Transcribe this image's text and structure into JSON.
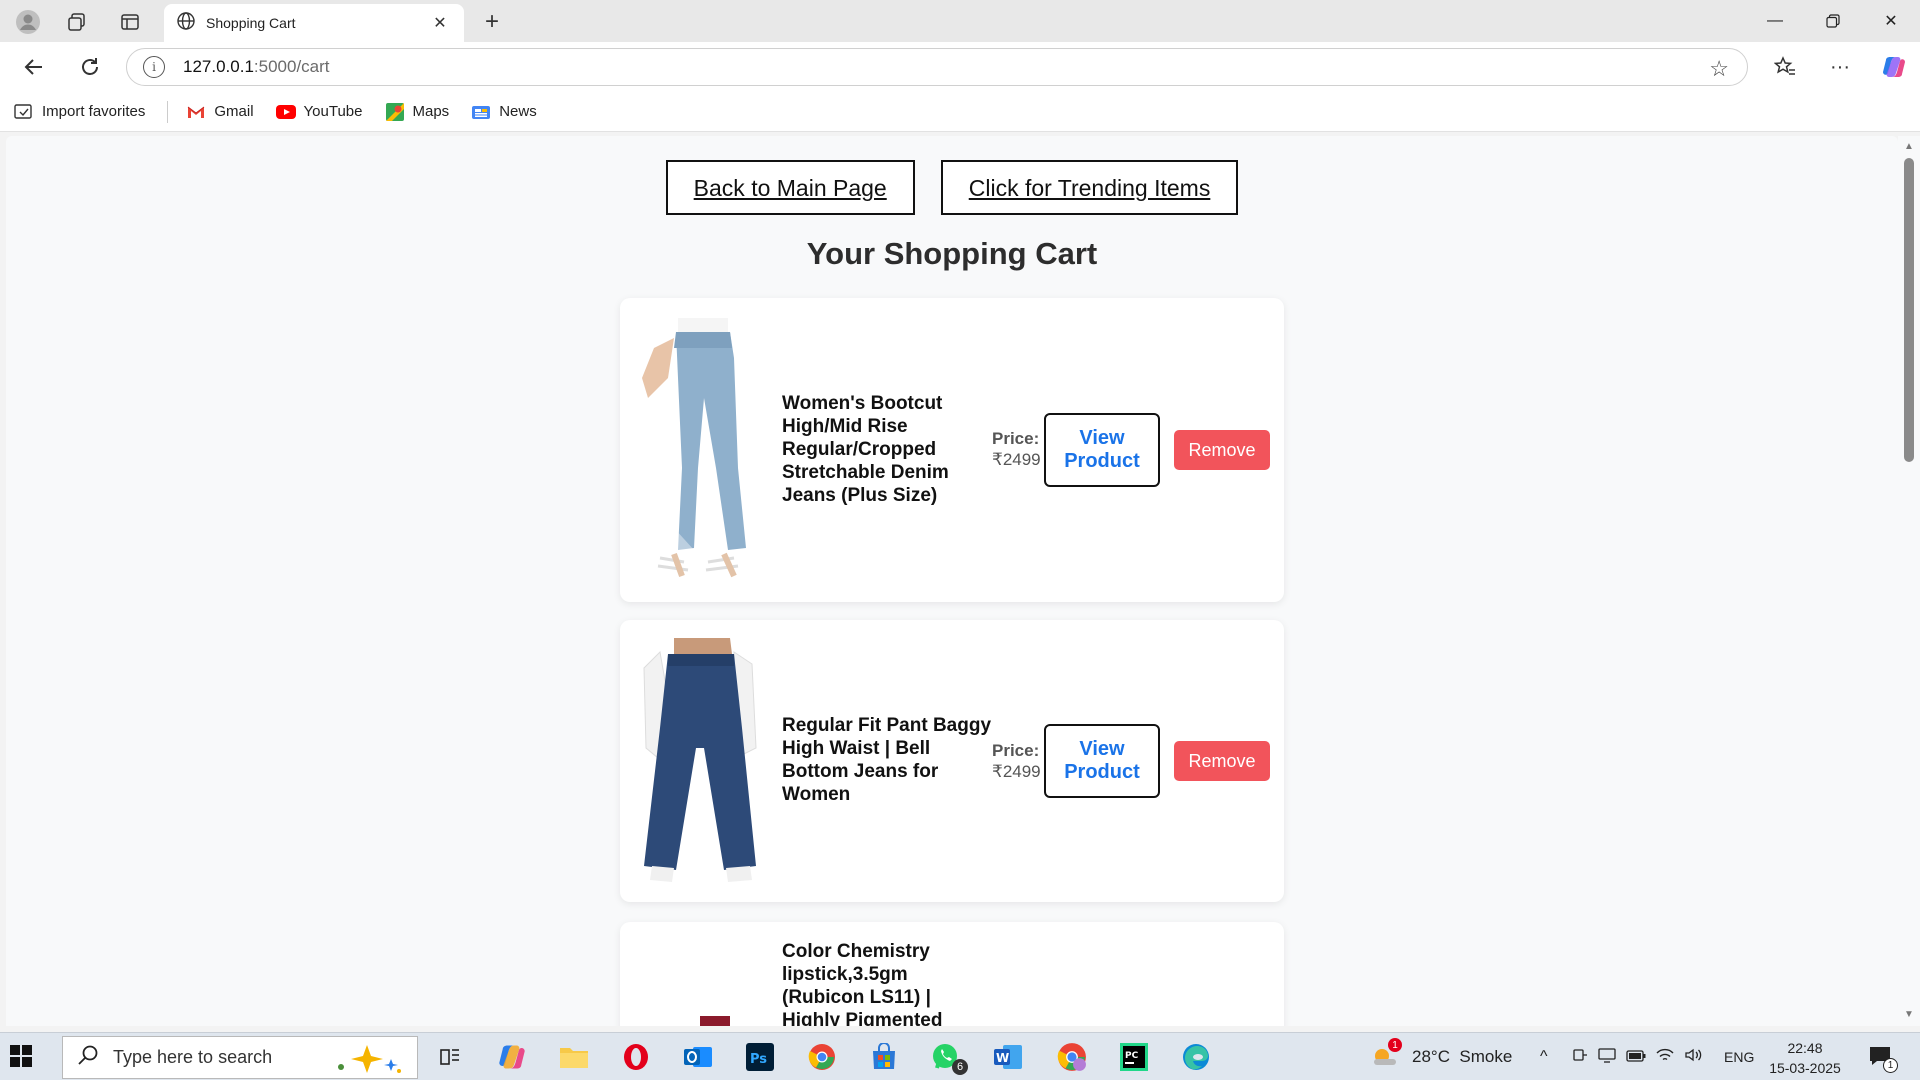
{
  "browser": {
    "tab_title": "Shopping Cart",
    "url_host": "127.0.0.1",
    "url_path": ":5000/cart",
    "bookmarks": [
      {
        "label": "Import favorites",
        "icon": "import-icon"
      },
      {
        "label": "Gmail",
        "icon": "gmail-icon"
      },
      {
        "label": "YouTube",
        "icon": "youtube-icon"
      },
      {
        "label": "Maps",
        "icon": "maps-icon"
      },
      {
        "label": "News",
        "icon": "news-icon"
      }
    ]
  },
  "page": {
    "back_link": "Back to Main Page",
    "trending_link": "Click for Trending Items",
    "title": "Your Shopping Cart",
    "price_label": "Price:",
    "view_label_1": "View",
    "view_label_2": "Product",
    "remove_label": "Remove",
    "cart_items": [
      {
        "name": "Women's Bootcut High/Mid Rise Regular/Cropped Stretchable Denim Jeans (Plus Size)",
        "price": "₹2499",
        "image": "light-blue-bootcut-jeans"
      },
      {
        "name": "Regular Fit Pant Baggy High Waist | Bell Bottom Jeans for Women",
        "price": "₹2499",
        "image": "dark-blue-baggy-jeans"
      },
      {
        "name": "Color Chemistry lipstick,3.5gm (Rubicon LS11) | Highly Pigmented",
        "price": "",
        "image": "lipstick"
      }
    ]
  },
  "taskbar": {
    "search_placeholder": "Type here to search",
    "weather": "28°C  Smoke",
    "weather_badge": "1",
    "whatsapp_badge": "6",
    "language": "ENG",
    "time": "22:48",
    "date": "15-03-2025",
    "notification_count": "1"
  },
  "colors": {
    "remove_button": "#f2545b",
    "view_link_text": "#1a73e8",
    "page_background": "#f8f9fa"
  }
}
